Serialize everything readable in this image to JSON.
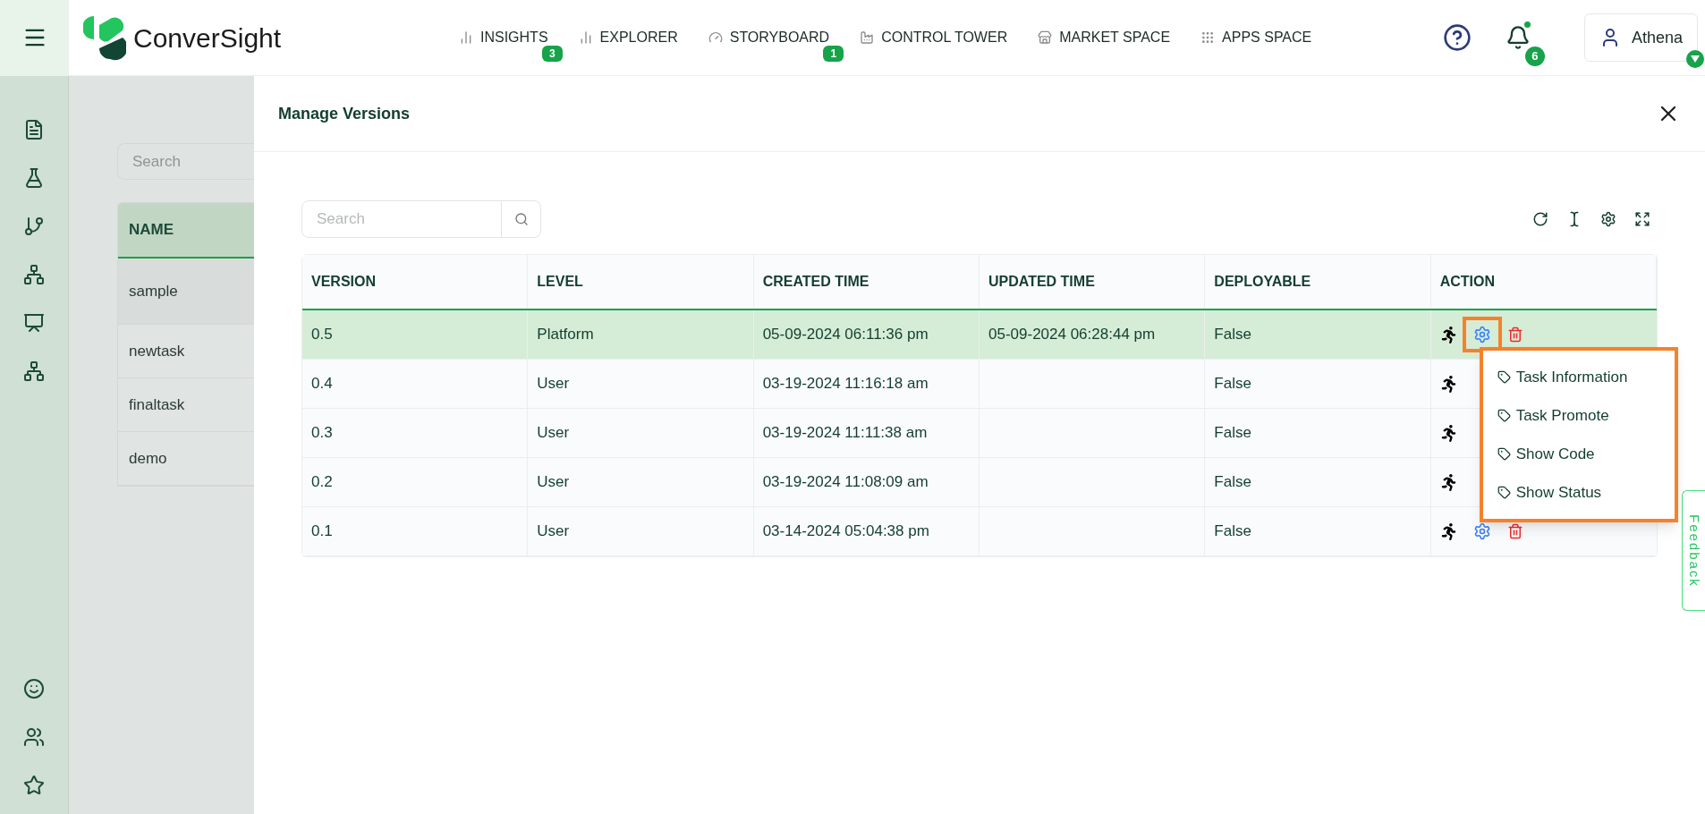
{
  "brand": "ConverSight",
  "nav_items": [
    {
      "label": "INSIGHTS",
      "badge": "3"
    },
    {
      "label": "EXPLORER"
    },
    {
      "label": "STORYBOARD",
      "badge": "1"
    },
    {
      "label": "CONTROL TOWER"
    },
    {
      "label": "MARKET SPACE"
    },
    {
      "label": "APPS SPACE"
    }
  ],
  "notifications": {
    "count": "6",
    "unread": true
  },
  "user": {
    "name": "Athena"
  },
  "background_page": {
    "search": {
      "placeholder": "Search"
    },
    "table": {
      "columns": [
        "NAME"
      ],
      "rows": [
        {
          "name": "sample",
          "selected": true
        },
        {
          "name": "newtask",
          "selected": false
        },
        {
          "name": "finaltask",
          "selected": false
        },
        {
          "name": "demo",
          "selected": false
        }
      ]
    }
  },
  "dialog": {
    "title": "Manage Versions",
    "search": {
      "placeholder": "Search"
    },
    "table": {
      "columns": [
        "VERSION",
        "LEVEL",
        "CREATED TIME",
        "UPDATED TIME",
        "DEPLOYABLE",
        "ACTION"
      ],
      "rows": [
        {
          "version": "0.5",
          "level": "Platform",
          "created_time": "05-09-2024 06:11:36 pm",
          "updated_time": "05-09-2024 06:28:44 pm",
          "deployable": "False",
          "selected": true,
          "menu_open": true
        },
        {
          "version": "0.4",
          "level": "User",
          "created_time": "03-19-2024 11:16:18 am",
          "updated_time": "",
          "deployable": "False",
          "selected": false,
          "menu_open": false
        },
        {
          "version": "0.3",
          "level": "User",
          "created_time": "03-19-2024 11:11:38 am",
          "updated_time": "",
          "deployable": "False",
          "selected": false,
          "menu_open": false
        },
        {
          "version": "0.2",
          "level": "User",
          "created_time": "03-19-2024 11:08:09 am",
          "updated_time": "",
          "deployable": "False",
          "selected": false,
          "menu_open": false
        },
        {
          "version": "0.1",
          "level": "User",
          "created_time": "03-14-2024 05:04:38 pm",
          "updated_time": "",
          "deployable": "False",
          "selected": false,
          "menu_open": false
        }
      ]
    },
    "action_menu": [
      "Task Information",
      "Task Promote",
      "Show Code",
      "Show Status"
    ]
  },
  "feedback": "Feedback"
}
